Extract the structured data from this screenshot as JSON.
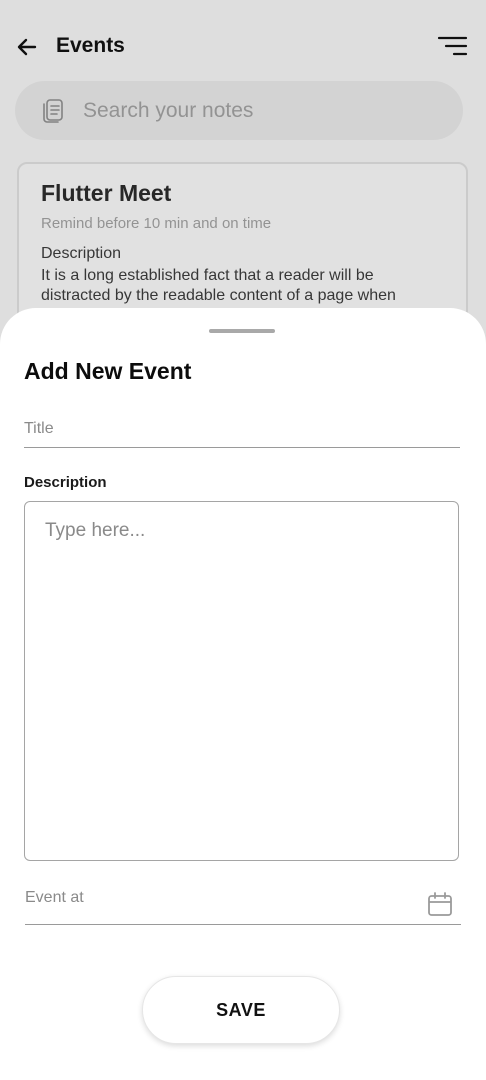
{
  "appbar": {
    "title": "Events",
    "back_icon": "arrow-left-icon",
    "menu_icon": "sort-lines-icon"
  },
  "search": {
    "placeholder": "Search your notes",
    "icon": "notes-stack-icon"
  },
  "note_card": {
    "title": "Flutter Meet",
    "remind": "Remind before 10 min and on time",
    "description_label": "Description",
    "description": "It is a long established fact that a reader will be distracted by the readable content of a page when"
  },
  "sheet": {
    "title": "Add New Event",
    "title_placeholder": "Title",
    "description_label": "Description",
    "description_placeholder": "Type here...",
    "event_at_placeholder": "Event at",
    "calendar_icon": "calendar-icon",
    "save_label": "SAVE"
  },
  "colors": {
    "background": "#e8e8e8",
    "sheet": "#ffffff",
    "text_primary": "#111111",
    "text_muted": "#9a9a9a"
  }
}
